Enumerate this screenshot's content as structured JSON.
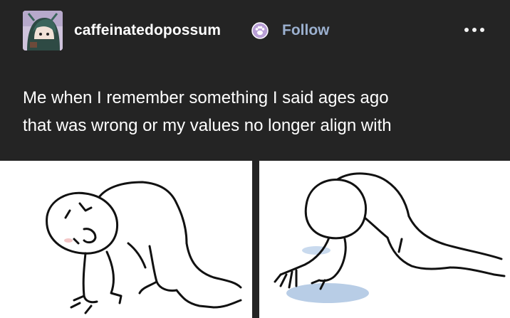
{
  "post": {
    "username": "caffeinatedopossum",
    "badge_icon": "paw-badge-icon",
    "follow_label": "Follow",
    "more_icon": "more-options-icon",
    "caption_lines": [
      "Me when I remember something I said ages ago",
      "that was wrong or my values no longer align with"
    ]
  },
  "colors": {
    "background": "#242424",
    "text": "#ffffff",
    "follow_link": "#9bb0cf",
    "puddle": "#b8cde6"
  }
}
